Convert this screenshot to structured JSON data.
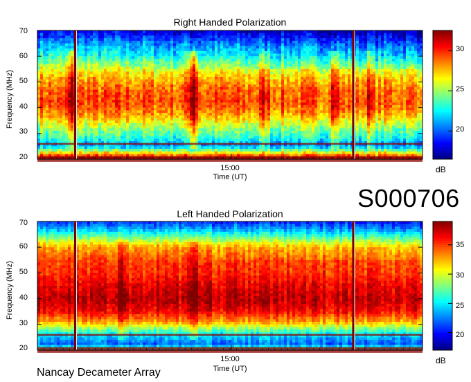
{
  "stamp_id": "S000706",
  "credit": "Nancay Decameter Array",
  "chart_data": [
    {
      "type": "heatmap",
      "title": "Right Handed Polarization",
      "xlabel": "Time (UT)",
      "ylabel": "Frequency (MHz)",
      "x_tick_labels": [
        "15:00"
      ],
      "y_ticks": [
        20,
        30,
        40,
        50,
        60,
        70
      ],
      "ylim": [
        20,
        70
      ],
      "colorbar": {
        "label": "dB",
        "ticks": [
          20,
          25,
          30
        ],
        "range": [
          16.5,
          32.5
        ]
      },
      "profile": [
        [
          20,
          31
        ],
        [
          21,
          30
        ],
        [
          22,
          28
        ],
        [
          25,
          21
        ],
        [
          28,
          23
        ],
        [
          32,
          25
        ],
        [
          37,
          28
        ],
        [
          42,
          29.5
        ],
        [
          47,
          29
        ],
        [
          52,
          27.5
        ],
        [
          56,
          25.5
        ],
        [
          60,
          23
        ],
        [
          65,
          21
        ],
        [
          70,
          18
        ]
      ],
      "bursts": [
        {
          "time": 0.09,
          "value": 3
        },
        {
          "time": 0.405,
          "value": 5
        },
        {
          "time": 0.59,
          "value": 2
        },
        {
          "time": 0.77,
          "value": 3
        },
        {
          "time": 0.86,
          "value": 2
        }
      ],
      "vertical_lines": [
        0.098,
        0.82
      ]
    },
    {
      "type": "heatmap",
      "title": "Left Handed Polarization",
      "xlabel": "Time (UT)",
      "ylabel": "Frequency (MHz)",
      "x_tick_labels": [
        "15:00"
      ],
      "y_ticks": [
        20,
        30,
        40,
        50,
        60,
        70
      ],
      "ylim": [
        20,
        70
      ],
      "colorbar": {
        "label": "dB",
        "ticks": [
          20,
          25,
          30,
          35
        ],
        "range": [
          17,
          39
        ]
      },
      "profile": [
        [
          20,
          26
        ],
        [
          21,
          27
        ],
        [
          22,
          22
        ],
        [
          25,
          24
        ],
        [
          28,
          28
        ],
        [
          31,
          33
        ],
        [
          35,
          36.5
        ],
        [
          40,
          38
        ],
        [
          45,
          37
        ],
        [
          50,
          35.5
        ],
        [
          55,
          35
        ],
        [
          60,
          33
        ],
        [
          64,
          28
        ],
        [
          67,
          24
        ],
        [
          70,
          21
        ]
      ],
      "bursts": [
        {
          "time": 0.22,
          "value": 2
        },
        {
          "time": 0.405,
          "value": 3
        },
        {
          "time": 0.5,
          "value": 1.5
        }
      ],
      "vertical_lines": [
        0.098,
        0.82
      ]
    }
  ]
}
